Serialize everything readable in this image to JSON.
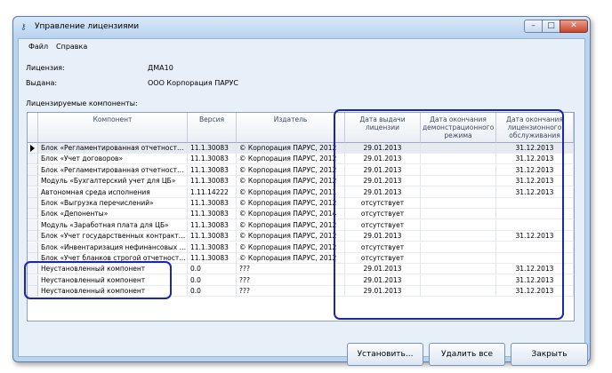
{
  "window": {
    "title": "Управление лицензиями"
  },
  "menu": [
    {
      "label": "Файл"
    },
    {
      "label": "Справка"
    }
  ],
  "info": {
    "license_label": "Лицензия:",
    "license_value": "ДМА10",
    "issued_label": "Выдана:",
    "issued_value": "ООО Корпорация ПАРУС"
  },
  "components_label": "Лицензируемые компоненты:",
  "columns": [
    {
      "label": "Компонент"
    },
    {
      "label": "Версия"
    },
    {
      "label": "Издатель"
    },
    {
      "label": "Дата выдачи лицензии"
    },
    {
      "label": "Дата окончания демонстрационного режима"
    },
    {
      "label": "Дата окончания лицензионного обслуживания"
    }
  ],
  "rows": [
    {
      "component": "Блок «Регламентированная отчетность …",
      "version": "11.1.30083",
      "publisher": "© Корпорация ПАРУС, 2012",
      "issue_date": "29.01.2013",
      "demo_end": "",
      "service_end": "31.12.2013"
    },
    {
      "component": "Блок «Учет договоров»",
      "version": "11.1.30083",
      "publisher": "© Корпорация ПАРУС, 2012",
      "issue_date": "29.01.2013",
      "demo_end": "",
      "service_end": "31.12.2013"
    },
    {
      "component": "Блок «Регламентированная отчетность …",
      "version": "11.1.30083",
      "publisher": "© Корпорация ПАРУС, 2012",
      "issue_date": "29.01.2013",
      "demo_end": "",
      "service_end": "31.12.2013"
    },
    {
      "component": "Модуль «Бухгалтерский учет для ЦБ»",
      "version": "11.1.30083",
      "publisher": "© Корпорация ПАРУС, 2012",
      "issue_date": "29.01.2013",
      "demo_end": "",
      "service_end": "31.12.2013"
    },
    {
      "component": "Автономная среда исполнения",
      "version": "1.11.14222",
      "publisher": "© Корпорация ПАРУС, 2011",
      "issue_date": "29.01.2013",
      "demo_end": "",
      "service_end": "31.12.2013"
    },
    {
      "component": "Блок «Выгрузка перечислений»",
      "version": "11.1.30083",
      "publisher": "© Корпорация ПАРУС, 2012",
      "issue_date": "отсутствует",
      "demo_end": "",
      "service_end": ""
    },
    {
      "component": "Блок «Депоненты»",
      "version": "11.1.30083",
      "publisher": "© Корпорация ПАРУС, 2014",
      "issue_date": "отсутствует",
      "demo_end": "",
      "service_end": ""
    },
    {
      "component": "Модуль «Заработная плата для ЦБ»",
      "version": "11.1.30083",
      "publisher": "© Корпорация ПАРУС, 2012",
      "issue_date": "отсутствует",
      "demo_end": "",
      "service_end": ""
    },
    {
      "component": "Блок «Учет государственных контракто…",
      "version": "11.1.30083",
      "publisher": "© Корпорация ПАРУС, 2012",
      "issue_date": "29.01.2013",
      "demo_end": "",
      "service_end": "31.12.2013"
    },
    {
      "component": "Блок «Инвентаризация нефинансовых ак…",
      "version": "11.1.30083",
      "publisher": "© Корпорация ПАРУС, 2012",
      "issue_date": "отсутствует",
      "demo_end": "",
      "service_end": ""
    },
    {
      "component": "Блок «Учет бланков строгой отчетности»",
      "version": "11.1.30083",
      "publisher": "© Корпорация ПАРУС, 2012",
      "issue_date": "отсутствует",
      "demo_end": "",
      "service_end": ""
    },
    {
      "component": "Неустановленный компонент",
      "version": "0.0",
      "publisher": "???",
      "issue_date": "29.01.2013",
      "demo_end": "",
      "service_end": "31.12.2013"
    },
    {
      "component": "Неустановленный компонент",
      "version": "0.0",
      "publisher": "???",
      "issue_date": "29.01.2013",
      "demo_end": "",
      "service_end": "31.12.2013"
    },
    {
      "component": "Неустановленный компонент",
      "version": "0.0",
      "publisher": "???",
      "issue_date": "29.01.2013",
      "demo_end": "",
      "service_end": "31.12.2013"
    }
  ],
  "buttons": {
    "install": "Установить...",
    "delete_all": "Удалить все",
    "close": "Закрыть"
  },
  "colors": {
    "highlight_outline": "#1c25b0",
    "window_frame": "#b9d4ee"
  },
  "icons": {
    "app": "key-icon",
    "minimize": "minimize-icon",
    "maximize": "maximize-icon",
    "close": "close-icon"
  }
}
